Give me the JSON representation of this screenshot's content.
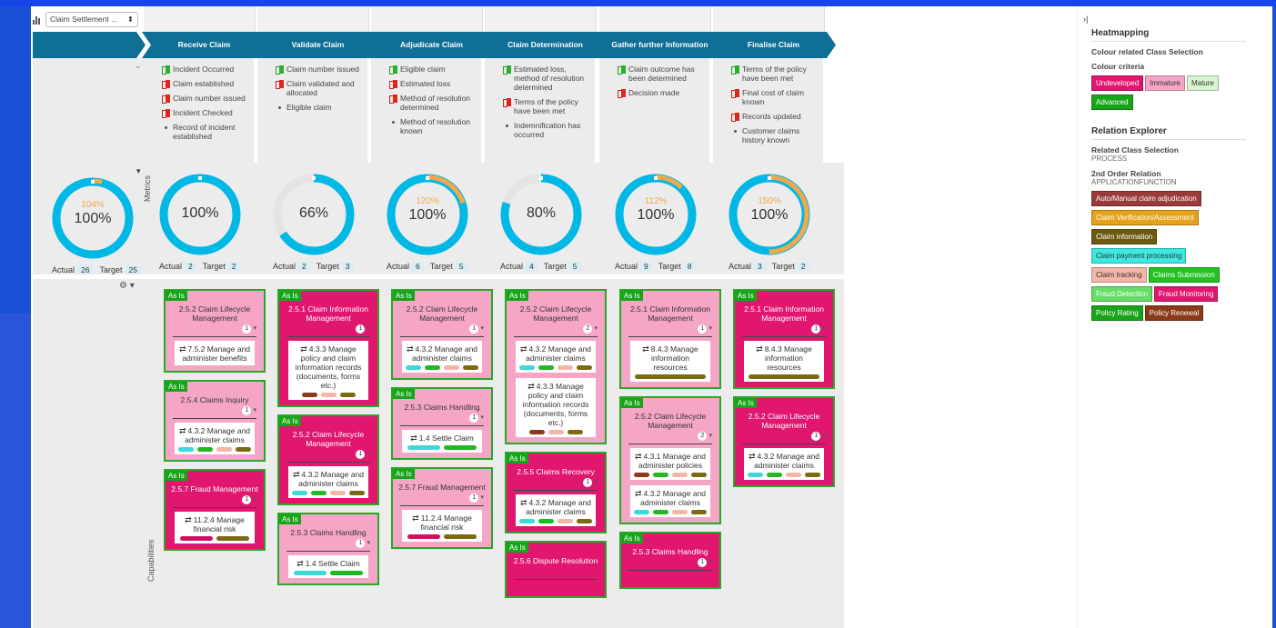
{
  "selector": {
    "value": "Claim Settlement ...",
    "caret": "⬍"
  },
  "stages": [
    {
      "label": "Receive Claim",
      "events": [
        {
          "kind": "green",
          "text": "Incident Occurred"
        },
        {
          "kind": "red",
          "text": "Claim established"
        },
        {
          "kind": "red",
          "text": "Claim number issued"
        },
        {
          "kind": "red",
          "text": "Incident Checked"
        },
        {
          "kind": "dot",
          "text": "Record of incident established"
        }
      ],
      "metric": {
        "pct": "100%",
        "over": "",
        "actual": "2",
        "target": "2",
        "fill": 1.0,
        "extra": 0
      }
    },
    {
      "label": "Validate Claim",
      "events": [
        {
          "kind": "green",
          "text": "Claim number issued"
        },
        {
          "kind": "red",
          "text": "Claim validated and allocated"
        },
        {
          "kind": "dot",
          "text": "Eligible claim"
        }
      ],
      "metric": {
        "pct": "66%",
        "over": "",
        "actual": "2",
        "target": "3",
        "fill": 0.66,
        "extra": 0
      }
    },
    {
      "label": "Adjudicate Claim",
      "events": [
        {
          "kind": "green",
          "text": "Eligible claim"
        },
        {
          "kind": "red",
          "text": "Estimated loss"
        },
        {
          "kind": "red",
          "text": "Method of resolution determined"
        },
        {
          "kind": "dot",
          "text": "Method of resolution known"
        }
      ],
      "metric": {
        "pct": "100%",
        "over": "120%",
        "actual": "6",
        "target": "5",
        "fill": 1.0,
        "extra": 0.2
      }
    },
    {
      "label": "Claim Determination",
      "events": [
        {
          "kind": "green",
          "text": "Estimated loss, method of resolution determined"
        },
        {
          "kind": "red",
          "text": "Terms of the policy have been met"
        },
        {
          "kind": "dot",
          "text": "Indemnification has occurred"
        }
      ],
      "metric": {
        "pct": "80%",
        "over": "",
        "actual": "4",
        "target": "5",
        "fill": 0.8,
        "extra": 0
      }
    },
    {
      "label": "Gather further Information",
      "events": [
        {
          "kind": "green",
          "text": "Claim outcome has been determined"
        },
        {
          "kind": "red",
          "text": "Decision made"
        }
      ],
      "metric": {
        "pct": "100%",
        "over": "112%",
        "actual": "9",
        "target": "8",
        "fill": 1.0,
        "extra": 0.12
      }
    },
    {
      "label": "Finalise Claim",
      "events": [
        {
          "kind": "green",
          "text": "Terms of the policy have been met"
        },
        {
          "kind": "red",
          "text": "Final cost of claim known"
        },
        {
          "kind": "red",
          "text": "Records updated"
        },
        {
          "kind": "dot",
          "text": "Customer claims history known"
        }
      ],
      "metric": {
        "pct": "100%",
        "over": "150%",
        "actual": "3",
        "target": "2",
        "fill": 1.0,
        "extra": 0.5
      }
    }
  ],
  "overall_metric": {
    "pct": "100%",
    "over": "104%",
    "actual": "26",
    "target": "25",
    "fill": 1.0,
    "extra": 0.04
  },
  "labels": {
    "actual": "Actual",
    "target": "Target",
    "metrics": "Metrics",
    "capabilities": "Capabilities",
    "as_is": "As Is"
  },
  "colors": {
    "cyan": "#00b8e6",
    "orange": "#f4a84a",
    "pink": "#f5a6c7",
    "magenta": "#e0166f",
    "green_border": "#27a827",
    "header": "#0f6f94"
  },
  "pill_colors": {
    "c": "#3dd9d9",
    "g": "#22b822",
    "p": "#f4b6a6",
    "o": "#7a6a12",
    "b": "#8a3a18",
    "m": "#d0105e"
  },
  "capabilities": [
    [
      {
        "style": "pink",
        "title": "2.5.2 Claim Lifecycle Management",
        "count": "1",
        "subs": [
          {
            "text": "7.5.2 Manage and administer benefits",
            "pills": []
          }
        ]
      },
      {
        "style": "pink",
        "title": "2.5.4 Claims Inquiry",
        "count": "1",
        "subs": [
          {
            "text": "4.3.2 Manage and administer claims",
            "pills": [
              "c",
              "g",
              "p",
              "o"
            ]
          }
        ]
      },
      {
        "style": "mag",
        "title": "2.5.7 Fraud Management",
        "count": "1",
        "subs": [
          {
            "text": "11.2.4 Manage financial risk",
            "pills": [
              "m",
              "o"
            ]
          }
        ]
      }
    ],
    [
      {
        "style": "mag",
        "title": "2.5.1 Claim Information Management",
        "count": "1",
        "subs": [
          {
            "text": "4.3.3 Manage policy and claim information records (documents, forms etc.)",
            "pills": [
              "b",
              "p",
              "o"
            ]
          }
        ]
      },
      {
        "style": "mag",
        "title": "2.5.2 Claim Lifecycle Management",
        "count": "1",
        "subs": [
          {
            "text": "4.3.2 Manage and administer claims",
            "pills": [
              "c",
              "g",
              "p",
              "o"
            ]
          }
        ]
      },
      {
        "style": "pink",
        "title": "2.5.3 Claims Handling",
        "count": "1",
        "subs": [
          {
            "text": "1.4 Settle Claim",
            "pills": [
              "c",
              "g"
            ]
          }
        ]
      }
    ],
    [
      {
        "style": "pink",
        "title": "2.5.2 Claim Lifecycle Management",
        "count": "1",
        "subs": [
          {
            "text": "4.3.2 Manage and administer claims",
            "pills": [
              "c",
              "g",
              "p",
              "o"
            ]
          }
        ]
      },
      {
        "style": "pink",
        "title": "2.5.3 Claims Handling",
        "count": "1",
        "subs": [
          {
            "text": "1.4 Settle Claim",
            "pills": [
              "c",
              "g"
            ]
          }
        ]
      },
      {
        "style": "pink",
        "title": "2.5.7 Fraud Management",
        "count": "1",
        "subs": [
          {
            "text": "11.2.4 Manage financial risk",
            "pills": [
              "m",
              "o"
            ]
          }
        ]
      }
    ],
    [
      {
        "style": "pink",
        "title": "2.5.2 Claim Lifecycle Management",
        "count": "2",
        "subs": [
          {
            "text": "4.3.2 Manage and administer claims",
            "pills": [
              "c",
              "g",
              "p",
              "o"
            ]
          },
          {
            "text": "4.3.3 Manage policy and claim information records (documents, forms etc.)",
            "pills": [
              "b",
              "p",
              "o"
            ]
          }
        ]
      },
      {
        "style": "mag",
        "title": "2.5.5 Claims Recovery",
        "count": "1",
        "subs": [
          {
            "text": "4.3.2 Manage and administer claims",
            "pills": [
              "c",
              "g",
              "p",
              "o"
            ]
          }
        ]
      },
      {
        "style": "mag",
        "title": "2.5.6 Dispute Resolution",
        "count": "",
        "subs": []
      }
    ],
    [
      {
        "style": "pink",
        "title": "2.5.1 Claim Information Management",
        "count": "1",
        "subs": [
          {
            "text": "8.4.3 Manage information resources",
            "pills": [
              "o"
            ]
          }
        ]
      },
      {
        "style": "pink",
        "title": "2.5.2 Claim Lifecycle Management",
        "count": "2",
        "subs": [
          {
            "text": "4.3.1 Manage and administer policies",
            "pills": [
              "b",
              "g",
              "p",
              "o"
            ]
          },
          {
            "text": "4.3.2 Manage and administer claims",
            "pills": [
              "c",
              "g",
              "p",
              "o"
            ]
          }
        ]
      },
      {
        "style": "mag",
        "title": "2.5.3 Claims Handling",
        "count": "1",
        "subs": []
      }
    ],
    [
      {
        "style": "mag",
        "title": "2.5.1 Claim Information Management",
        "count": "1",
        "subs": [
          {
            "text": "8.4.3 Manage information resources",
            "pills": [
              "o"
            ]
          }
        ]
      },
      {
        "style": "mag",
        "title": "2.5.2 Claim Lifecycle Management",
        "count": "1",
        "subs": [
          {
            "text": "4.3.2 Manage and administer claims",
            "pills": [
              "c",
              "g",
              "p",
              "o"
            ]
          }
        ]
      }
    ]
  ],
  "panel": {
    "caret": "›|",
    "heat_title": "Heatmapping",
    "colour_class_label": "Colour related Class Selection",
    "colour_criteria_label": "Colour criteria",
    "criteria": [
      {
        "label": "Undeveloped",
        "bg": "#e0166f",
        "fg": "#ffffff"
      },
      {
        "label": "Immature",
        "bg": "#f5a6c7",
        "fg": "#333333"
      },
      {
        "label": "Mature",
        "bg": "#d8f4d0",
        "fg": "#333333"
      },
      {
        "label": "Advanced",
        "bg": "#18a418",
        "fg": "#ffffff"
      }
    ],
    "relation_title": "Relation Explorer",
    "related_class_label": "Related Class Selection",
    "related_class_value": "PROCESS",
    "second_order_label": "2nd Order Relation",
    "second_order_value": "APPLICATIONFUNCTION",
    "relations": [
      {
        "label": "Auto/Manual claim adjudication",
        "bg": "#9a3a3a",
        "fg": "#ffffff"
      },
      {
        "label": "Claim Verification/Assessment",
        "bg": "#e6a21a",
        "fg": "#ffffff"
      },
      {
        "label": "Claim information",
        "bg": "#6b5a10",
        "fg": "#ffffff"
      },
      {
        "label": "Claim payment processing",
        "bg": "#3de8e0",
        "fg": "#333333"
      },
      {
        "label": "Claim tracking",
        "bg": "#f4b6a6",
        "fg": "#333333"
      },
      {
        "label": "Claims Submission",
        "bg": "#22c222",
        "fg": "#ffffff"
      },
      {
        "label": "Fraud Detection",
        "bg": "#66dd66",
        "fg": "#ffffff"
      },
      {
        "label": "Fraud Monitoring",
        "bg": "#e0166f",
        "fg": "#ffffff"
      },
      {
        "label": "Policy Rating",
        "bg": "#18a418",
        "fg": "#ffffff"
      },
      {
        "label": "Policy Renewal",
        "bg": "#8a3a18",
        "fg": "#ffffff"
      }
    ]
  }
}
